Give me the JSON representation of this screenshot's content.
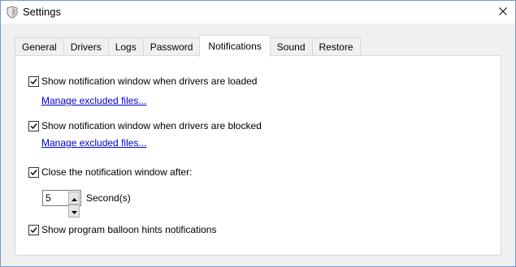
{
  "window": {
    "title": "Settings",
    "icon": "shield-icon",
    "close_icon": "close-icon"
  },
  "tabs": [
    {
      "label": "General",
      "active": false
    },
    {
      "label": "Drivers",
      "active": false
    },
    {
      "label": "Logs",
      "active": false
    },
    {
      "label": "Password",
      "active": false
    },
    {
      "label": "Notifications",
      "active": true
    },
    {
      "label": "Sound",
      "active": false
    },
    {
      "label": "Restore",
      "active": false
    }
  ],
  "notifications": {
    "drivers_loaded": {
      "label": "Show notification window when drivers are loaded",
      "checked": true
    },
    "manage_link_1": "Manage excluded files...",
    "drivers_blocked": {
      "label": "Show notification window when drivers are blocked",
      "checked": true
    },
    "manage_link_2": "Manage excluded files...",
    "close_after": {
      "label": "Close the notification window after:",
      "checked": true
    },
    "seconds_value": "5",
    "seconds_unit": "Second(s)",
    "balloon_hints": {
      "label": "Show program balloon hints notifications",
      "checked": true
    }
  },
  "colors": {
    "accent_border": "#6f9bd0",
    "link": "#0000cc",
    "background": "#f0f0f0"
  }
}
